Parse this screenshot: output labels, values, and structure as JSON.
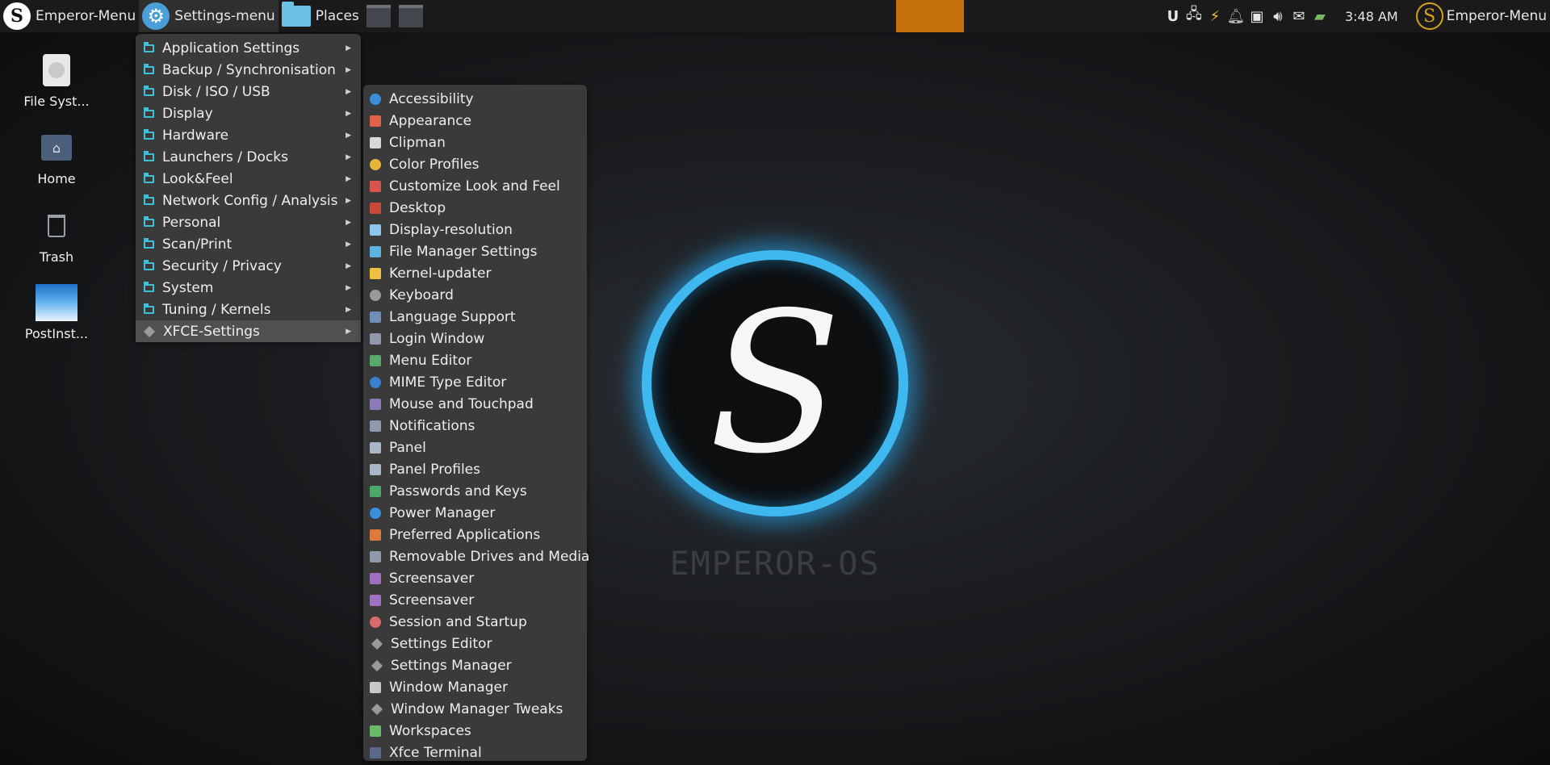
{
  "panel": {
    "emperor_menu_left": "Emperor-Menu",
    "settings_menu": "Settings-menu",
    "places": "Places",
    "clock": "3:48 AM",
    "emperor_menu_right": "Emperor-Menu",
    "tray_icons": [
      "u-icon",
      "network-icon",
      "usb-icon",
      "bell-icon",
      "display-icon",
      "volume-icon",
      "mail-icon",
      "battery-icon"
    ]
  },
  "desktop": {
    "icons": [
      {
        "label": "File Syst...",
        "icon": "drive-icon"
      },
      {
        "label": "Home",
        "icon": "home-folder-icon"
      },
      {
        "label": "Trash",
        "icon": "trash-icon"
      },
      {
        "label": "PostInst...",
        "icon": "image-icon"
      }
    ],
    "logo_text": "EMPEROR-OS"
  },
  "settings_menu": {
    "items": [
      {
        "label": "Application Settings"
      },
      {
        "label": "Backup / Synchronisation"
      },
      {
        "label": "Disk / ISO / USB"
      },
      {
        "label": "Display"
      },
      {
        "label": "Hardware"
      },
      {
        "label": "Launchers / Docks"
      },
      {
        "label": "Look&Feel"
      },
      {
        "label": "Network Config / Analysis"
      },
      {
        "label": "Personal"
      },
      {
        "label": "Scan/Print"
      },
      {
        "label": "Security / Privacy"
      },
      {
        "label": "System"
      },
      {
        "label": "Tuning / Kernels"
      },
      {
        "label": "XFCE-Settings"
      }
    ]
  },
  "xfce_submenu": {
    "items": [
      {
        "label": "Accessibility",
        "color": "#3a8fd9"
      },
      {
        "label": "Appearance",
        "color": "#e0604a"
      },
      {
        "label": "Clipman",
        "color": "#d8d8d8"
      },
      {
        "label": "Color Profiles",
        "color": "#e5b53a"
      },
      {
        "label": "Customize Look and Feel",
        "color": "#d9534f"
      },
      {
        "label": "Desktop",
        "color": "#c94a3a"
      },
      {
        "label": "Display-resolution",
        "color": "#8fc5ea"
      },
      {
        "label": "File Manager Settings",
        "color": "#5fb3e0"
      },
      {
        "label": "Kernel-updater",
        "color": "#f0c040"
      },
      {
        "label": "Keyboard",
        "color": "#9a9aa0"
      },
      {
        "label": "Language Support",
        "color": "#6f8fb8"
      },
      {
        "label": "Login Window",
        "color": "#8e9aab"
      },
      {
        "label": "Menu Editor",
        "color": "#5aa86a"
      },
      {
        "label": "MIME Type Editor",
        "color": "#3a7fd0"
      },
      {
        "label": "Mouse and Touchpad",
        "color": "#8c7ab8"
      },
      {
        "label": "Notifications",
        "color": "#8e9aab"
      },
      {
        "label": "Panel",
        "color": "#a9b7c8"
      },
      {
        "label": "Panel Profiles",
        "color": "#a9b7c8"
      },
      {
        "label": "Passwords and Keys",
        "color": "#4aa86a"
      },
      {
        "label": "Power Manager",
        "color": "#3a8fd9"
      },
      {
        "label": "Preferred Applications",
        "color": "#e07a3a"
      },
      {
        "label": "Removable Drives and Media",
        "color": "#8e9aab"
      },
      {
        "label": "Screensaver",
        "color": "#a070c0"
      },
      {
        "label": "Screensaver",
        "color": "#a070c0"
      },
      {
        "label": "Session and Startup",
        "color": "#d86a6a"
      },
      {
        "label": "Settings Editor",
        "color": "#9a9a9a"
      },
      {
        "label": "Settings Manager",
        "color": "#9a9a9a"
      },
      {
        "label": "Window Manager",
        "color": "#c8c8c8"
      },
      {
        "label": "Window Manager Tweaks",
        "color": "#9a9a9a"
      },
      {
        "label": "Workspaces",
        "color": "#6ab86a"
      },
      {
        "label": "Xfce Terminal",
        "color": "#5a6a8a"
      }
    ]
  },
  "colors": {
    "accent": "#3fb8f0",
    "orange_block": "#c46e0c",
    "menu_bg": "#3a3a3a",
    "folder_icon": "#3ec0d8"
  }
}
